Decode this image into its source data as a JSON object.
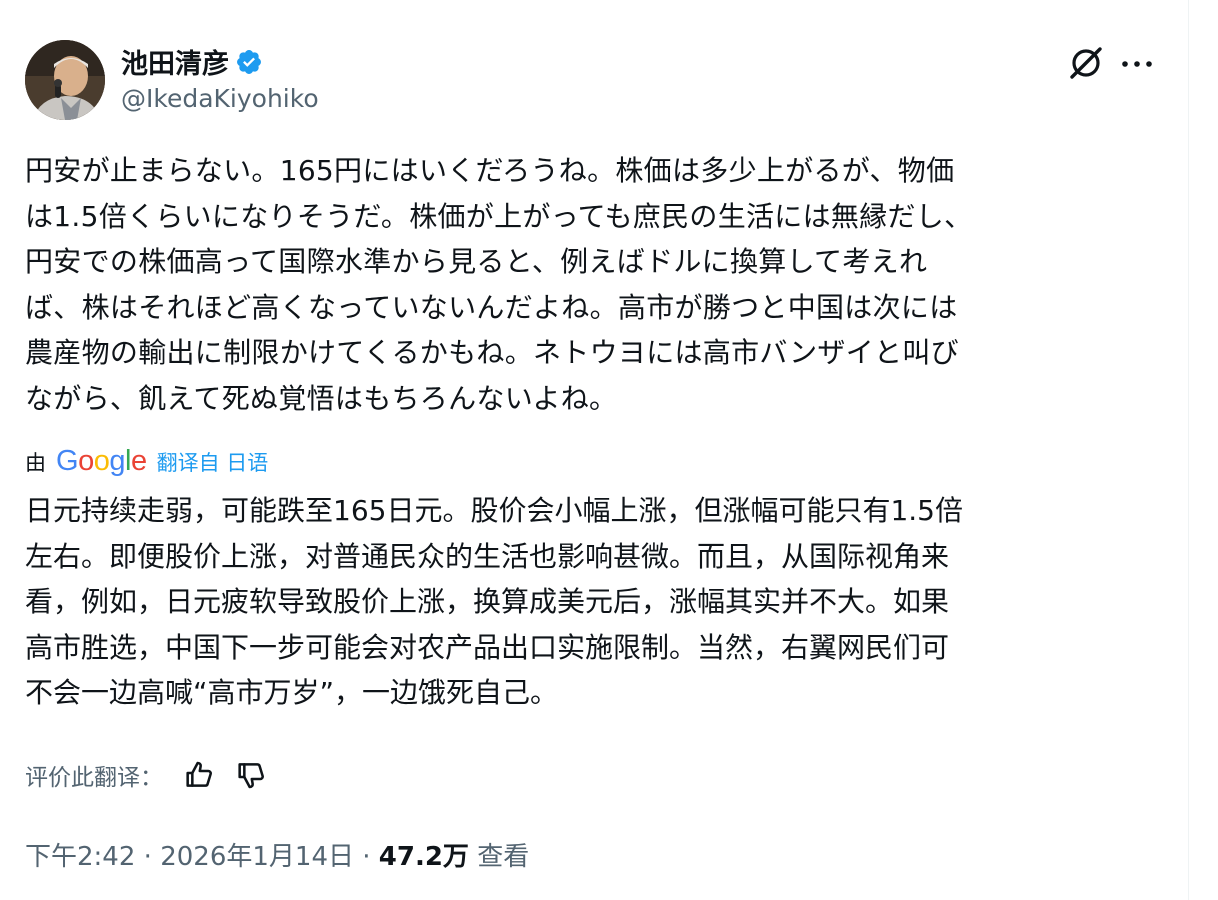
{
  "author": {
    "name": "池田清彦",
    "handle": "@IkedaKiyohiko",
    "verified": true
  },
  "icons": {
    "verified": "verified-badge-icon",
    "grok": "grok-icon",
    "more": "more-options-icon",
    "thumbs_up": "thumbs-up-icon",
    "thumbs_down": "thumbs-down-icon"
  },
  "post": {
    "original_lines": [
      "円安が止まらない。165円にはいくだろうね。株価は多少上がるが、物価",
      "は1.5倍くらいになりそうだ。株価が上がっても庶民の生活には無縁だし、",
      "円安での株価高って国際水準から見ると、例えばドルに換算して考えれ",
      "ば、株はそれほど高くなっていないんだよね。高市が勝つと中国は次には",
      "農産物の輸出に制限かけてくるかもね。ネトウヨには高市バンザイと叫び",
      "ながら、飢えて死ぬ覚悟はもちろんないよね。"
    ],
    "translation_by": "由",
    "translation_provider": "Google",
    "translated_from": "翻译自 日语",
    "translated_lines": [
      "日元持续走弱，可能跌至165日元。股价会小幅上涨，但涨幅可能只有1.5倍",
      "左右。即便股价上涨，对普通民众的生活也影响甚微。而且，从国际视角来",
      "看，例如，日元疲软导致股价上涨，换算成美元后，涨幅其实并不大。如果",
      "高市胜选，中国下一步可能会对农产品出口实施限制。当然，右翼网民们可",
      "不会一边高喊“高市万岁”，一边饿死自己。"
    ]
  },
  "rate": {
    "label": "评价此翻译："
  },
  "meta": {
    "time": "下午2:42",
    "separator": "·",
    "date": "2026年1月14日",
    "views_count": "47.2万",
    "views_label": "查看"
  },
  "colors": {
    "text": "#0f1419",
    "secondary": "#536471",
    "link": "#1d9bf0",
    "verified": "#1d9bf0"
  }
}
